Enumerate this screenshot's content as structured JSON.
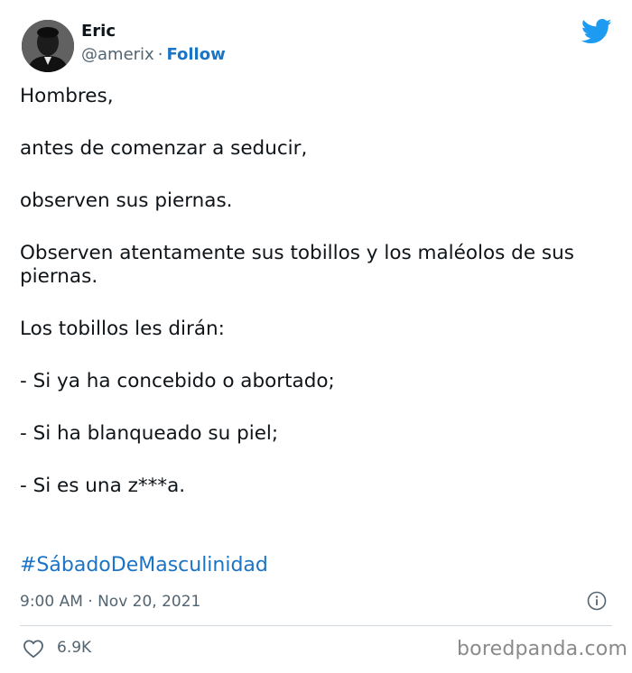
{
  "author": {
    "name": "Eric",
    "handle": "@amerix",
    "separator": "·",
    "follow_label": "Follow"
  },
  "brand": {
    "logo_icon": "twitter-bird-icon",
    "accent_color": "#1d9bf0",
    "link_color": "#1b74c5"
  },
  "tweet": {
    "lines": [
      "Hombres,",
      "antes de comenzar a seducir,",
      "observen sus piernas.",
      "Observen atentamente sus tobillos y los maléolos de sus piernas.",
      "Los tobillos les dirán:",
      "- Si ya ha concebido o abortado;",
      "- Si ha blanqueado su piel;",
      "- Si es una z***a."
    ],
    "hashtag": "#SábadoDeMasculinidad",
    "timestamp": "9:00 AM · Nov 20, 2021"
  },
  "actions": {
    "like_icon": "heart-icon",
    "like_count": "6.9K",
    "info_icon": "info-icon"
  },
  "watermark": "boredpanda.com"
}
